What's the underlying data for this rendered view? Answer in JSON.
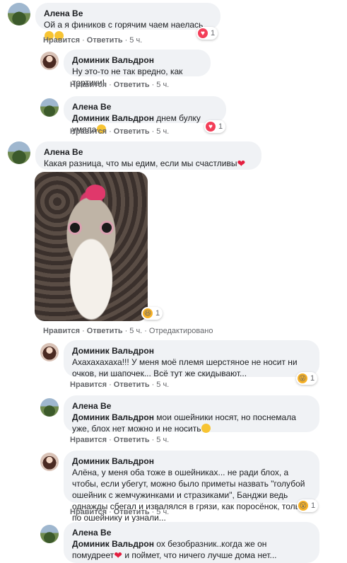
{
  "actions": {
    "like": "Нравится",
    "reply": "Ответить",
    "time": "5 ч.",
    "edited": "Отредактировано"
  },
  "comments": [
    {
      "author": "Алена Ве",
      "text": "Ой а я фиников с горячим чаем наелась",
      "reaction_count": "1",
      "reaction_type": "love"
    },
    {
      "author": "Доминик Вальдрон",
      "text": "Ну это-то не так вредно, как тортики!"
    },
    {
      "author": "Алена Ве",
      "mention": "Доминик Вальдрон",
      "text": " днем булку умяла",
      "reaction_count": "1",
      "reaction_type": "love"
    },
    {
      "author": "Алена Ве",
      "text": "Какая разница, что мы едим, если мы счастливы",
      "reaction_count": "1",
      "reaction_type": "haha"
    },
    {
      "author": "Доминик Вальдрон",
      "text": "Ахахахахаха!!! У меня моё племя шерстяное не носит ни очков, ни шапочек... Всё тут же скидывают...",
      "reaction_count": "1",
      "reaction_type": "haha"
    },
    {
      "author": "Алена Ве",
      "mention": "Доминик Вальдрон",
      "text": " мои ошейники носят, но поснемала уже, блох нет можно и не носить"
    },
    {
      "author": "Доминик Вальдрон",
      "text": "Алёна, у меня оба тоже в ошейниках... не ради блох, а чтобы, если убегут, можно было приметы назвать \"голубой ошейник с жемчужинками и стразиками\", Банджи ведь однажды сбегал и извалялся в грязи, как поросёнок, только по ошейнику и узнали...",
      "reaction_count": "1",
      "reaction_type": "wow"
    },
    {
      "author": "Алена Ве",
      "mention": "Доминик Вальдрон",
      "text": " ох безобразник..когда же он помудреет",
      "text2": " и поймет, что ничего лучше дома нет..."
    }
  ],
  "colors": {
    "bubble": "#f0f2f5",
    "love": "#f33e58",
    "haha": "#f7b125",
    "meta": "#65676b"
  }
}
